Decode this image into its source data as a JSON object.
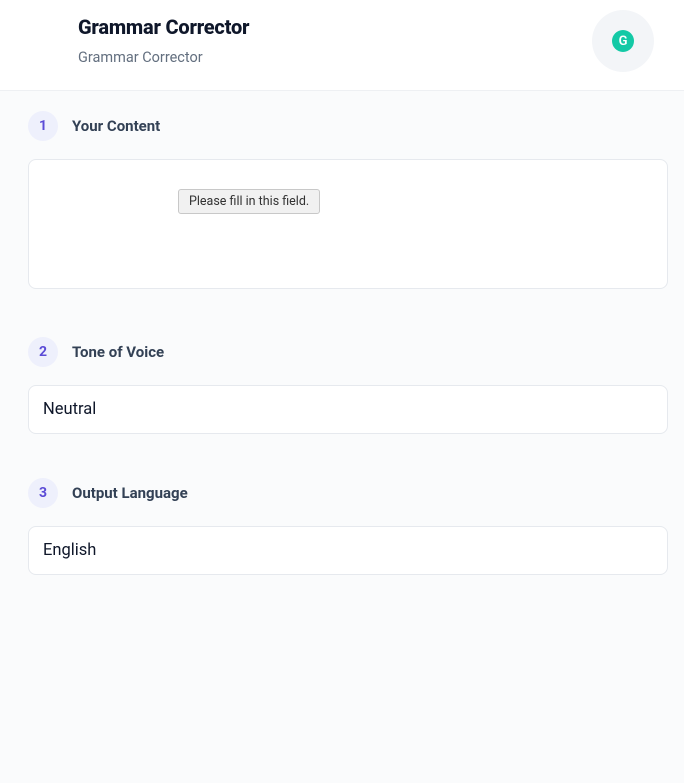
{
  "header": {
    "title": "Grammar Corrector",
    "subtitle": "Grammar Corrector",
    "badge_letter": "G"
  },
  "steps": {
    "content": {
      "num": "1",
      "label": "Your Content",
      "value": "",
      "tooltip": "Please fill in this field."
    },
    "tone": {
      "num": "2",
      "label": "Tone of Voice",
      "value": "Neutral"
    },
    "language": {
      "num": "3",
      "label": "Output Language",
      "value": "English"
    }
  }
}
